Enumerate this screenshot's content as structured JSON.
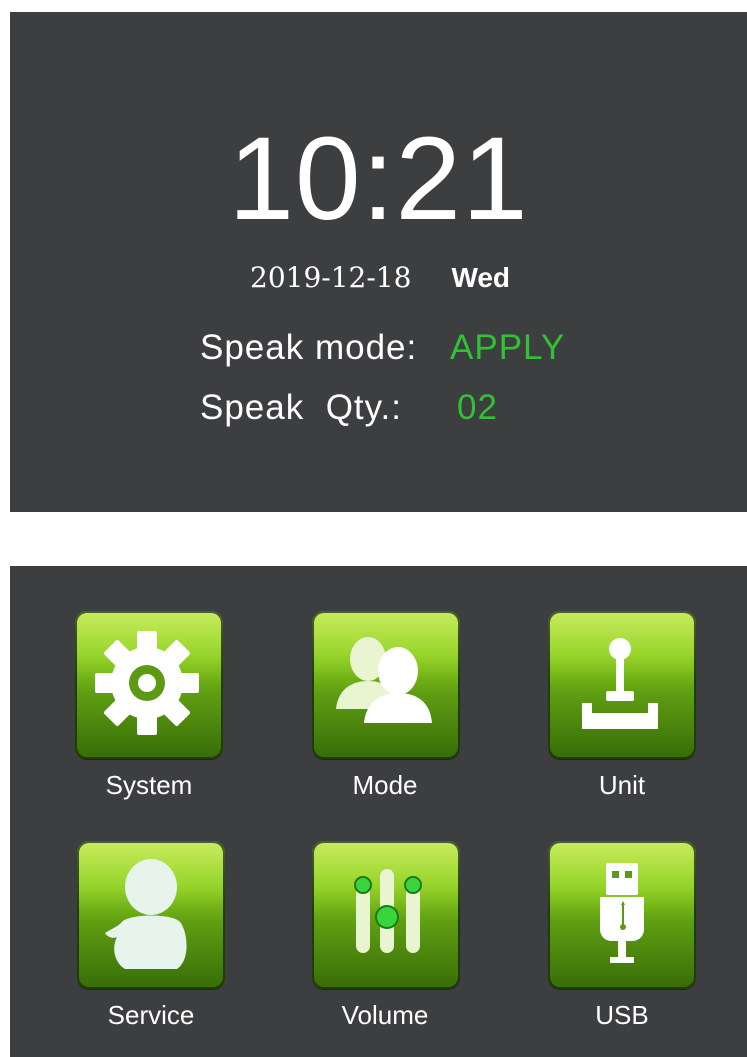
{
  "status": {
    "time": "10:21",
    "date": "2019-12-18",
    "weekday": "Wed",
    "speak_mode_label": "Speak mode:",
    "speak_mode_value": "APPLY",
    "speak_qty_label": "Speak  Qty.:",
    "speak_qty_value": "02"
  },
  "menu": {
    "items": [
      {
        "label": "System",
        "icon": "gear-icon"
      },
      {
        "label": "Mode",
        "icon": "users-icon"
      },
      {
        "label": "Unit",
        "icon": "joystick-icon"
      },
      {
        "label": "Service",
        "icon": "service-person-icon"
      },
      {
        "label": "Volume",
        "icon": "equalizer-icon"
      },
      {
        "label": "USB",
        "icon": "usb-icon"
      }
    ]
  },
  "colors": {
    "screen_bg": "#3d3e40",
    "accent_green": "#2fc233",
    "tile_green": "#8fd11c"
  }
}
